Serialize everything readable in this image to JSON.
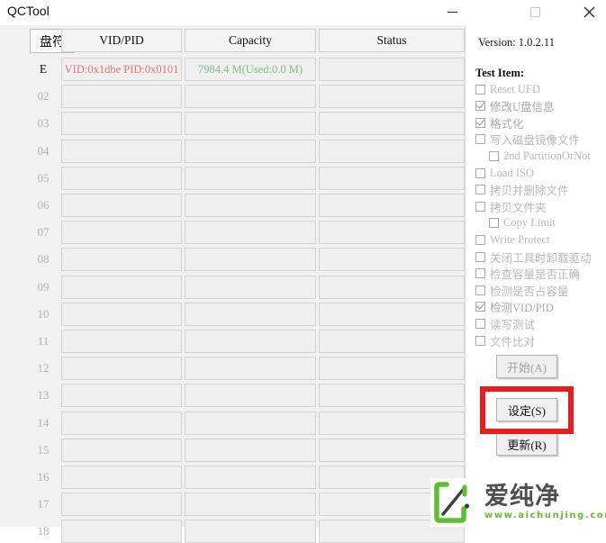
{
  "window": {
    "title": "QCTool",
    "minimize_icon": "minimize-icon",
    "maximize_icon": "maximize-icon",
    "close_icon": "close-icon"
  },
  "table": {
    "headers": {
      "drive": "盘符",
      "vidpid": "VID/PID",
      "capacity": "Capacity",
      "status": "Status"
    },
    "rows": [
      {
        "label": "E",
        "vidpid": "VID:0x1dbe PID:0x0101",
        "capacity": "7984.4 M(Used:0.0 M)",
        "status": "",
        "active": true
      },
      {
        "label": "02",
        "vidpid": "",
        "capacity": "",
        "status": "",
        "active": false
      },
      {
        "label": "03",
        "vidpid": "",
        "capacity": "",
        "status": "",
        "active": false
      },
      {
        "label": "04",
        "vidpid": "",
        "capacity": "",
        "status": "",
        "active": false
      },
      {
        "label": "05",
        "vidpid": "",
        "capacity": "",
        "status": "",
        "active": false
      },
      {
        "label": "06",
        "vidpid": "",
        "capacity": "",
        "status": "",
        "active": false
      },
      {
        "label": "07",
        "vidpid": "",
        "capacity": "",
        "status": "",
        "active": false
      },
      {
        "label": "08",
        "vidpid": "",
        "capacity": "",
        "status": "",
        "active": false
      },
      {
        "label": "09",
        "vidpid": "",
        "capacity": "",
        "status": "",
        "active": false
      },
      {
        "label": "10",
        "vidpid": "",
        "capacity": "",
        "status": "",
        "active": false
      },
      {
        "label": "11",
        "vidpid": "",
        "capacity": "",
        "status": "",
        "active": false
      },
      {
        "label": "12",
        "vidpid": "",
        "capacity": "",
        "status": "",
        "active": false
      },
      {
        "label": "13",
        "vidpid": "",
        "capacity": "",
        "status": "",
        "active": false
      },
      {
        "label": "14",
        "vidpid": "",
        "capacity": "",
        "status": "",
        "active": false
      },
      {
        "label": "15",
        "vidpid": "",
        "capacity": "",
        "status": "",
        "active": false
      },
      {
        "label": "16",
        "vidpid": "",
        "capacity": "",
        "status": "",
        "active": false
      },
      {
        "label": "17",
        "vidpid": "",
        "capacity": "",
        "status": "",
        "active": false
      },
      {
        "label": "18",
        "vidpid": "",
        "capacity": "",
        "status": "",
        "active": false
      }
    ]
  },
  "sidebar": {
    "version": "Version: 1.0.2.11",
    "test_item_label": "Test Item:",
    "test_items": [
      {
        "label": "Reset UFD",
        "checked": false,
        "indent": false
      },
      {
        "label": "修改U盘信息",
        "checked": true,
        "indent": false
      },
      {
        "label": "格式化",
        "checked": true,
        "indent": false
      },
      {
        "label": "写入磁盘镜像文件",
        "checked": false,
        "indent": false
      },
      {
        "label": "2nd PartitionOrNot",
        "checked": false,
        "indent": true
      },
      {
        "label": "Load ISO",
        "checked": false,
        "indent": false
      },
      {
        "label": "拷贝并删除文件",
        "checked": false,
        "indent": false
      },
      {
        "label": "拷贝文件夹",
        "checked": false,
        "indent": false
      },
      {
        "label": "Copy Limit",
        "checked": false,
        "indent": true
      },
      {
        "label": "Write Protect",
        "checked": false,
        "indent": false
      },
      {
        "label": "关闭工具时卸载驱动",
        "checked": false,
        "indent": false
      },
      {
        "label": "检查容量是否正确",
        "checked": false,
        "indent": false
      },
      {
        "label": "检测是否占容量",
        "checked": false,
        "indent": false
      },
      {
        "label": "检测VID/PID",
        "checked": true,
        "indent": false
      },
      {
        "label": "读写测试",
        "checked": false,
        "indent": false
      },
      {
        "label": "文件比对",
        "checked": false,
        "indent": false
      }
    ],
    "buttons": {
      "start": "开始(A)",
      "set": "设定(S)",
      "update": "更新(R)"
    },
    "highlight_color": "#e81d1d"
  },
  "watermark": {
    "brand": "爱纯净",
    "url": "www.aichunjing.com",
    "color": "#5fbe2e"
  },
  "colors": {
    "vidpid_text": "#e0756e",
    "capacity_text": "#7fbf7f",
    "panel_bg": "#f1f1f1"
  }
}
